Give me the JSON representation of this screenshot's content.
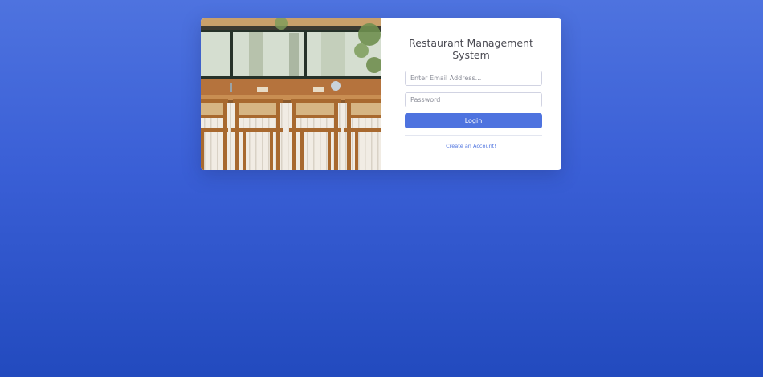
{
  "login": {
    "title": "Restaurant Management System",
    "email_placeholder": "Enter Email Address...",
    "password_placeholder": "Password",
    "login_label": "Login",
    "create_account_label": "Create an Account!"
  },
  "colors": {
    "primary": "#4e73df",
    "background_top": "#4e73df",
    "background_bottom": "#224abe"
  },
  "image": {
    "subject": "restaurant-bar-counter-with-wooden-stools"
  }
}
